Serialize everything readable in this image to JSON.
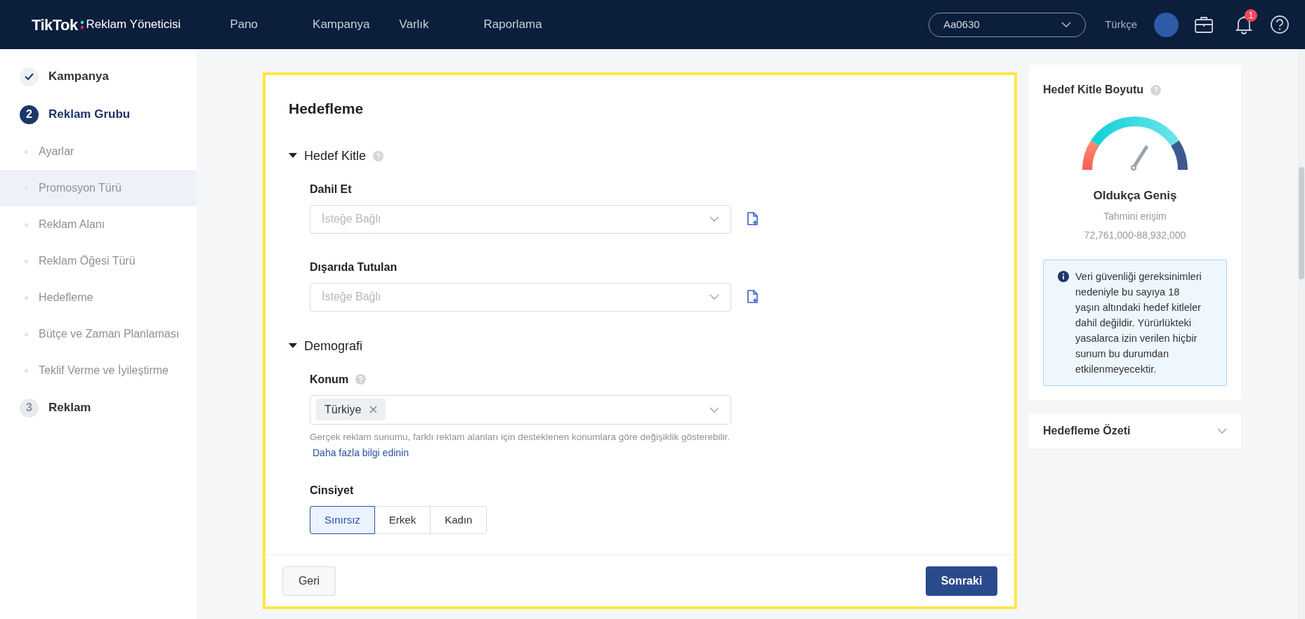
{
  "header": {
    "logo": "TikTok",
    "product": "Reklam Yöneticisi",
    "nav": [
      {
        "label": "Pano"
      },
      {
        "label": "Kampanya"
      },
      {
        "label": "Varlık"
      },
      {
        "label": "Raporlama"
      }
    ],
    "account": "Aa0630",
    "language": "Türkçe",
    "notification_count": "1"
  },
  "steps": [
    {
      "kind": "step",
      "label": "Kampanya",
      "completed": true,
      "selected": false
    },
    {
      "kind": "step",
      "number": "2",
      "label": "Reklam Grubu",
      "completed": false,
      "selected": true
    },
    {
      "kind": "substep",
      "label": "Ayarlar",
      "selected": false
    },
    {
      "kind": "substep",
      "label": "Promosyon Türü",
      "selected": true
    },
    {
      "kind": "substep",
      "label": "Reklam Alanı",
      "selected": false
    },
    {
      "kind": "substep",
      "label": "Reklam Öğesi Türü",
      "selected": false
    },
    {
      "kind": "substep",
      "label": "Hedefleme",
      "selected": false
    },
    {
      "kind": "substep",
      "label": "Bütçe ve Zaman Planlaması",
      "selected": false
    },
    {
      "kind": "substep",
      "label": "Teklif Verme ve İyileştirme",
      "selected": false
    },
    {
      "kind": "step",
      "number": "3",
      "label": "Reklam",
      "completed": false,
      "selected": false
    }
  ],
  "form": {
    "title": "Hedefleme",
    "sections": [
      {
        "title": "Hedef Kitle",
        "expanded": true,
        "help": true,
        "fields": [
          {
            "kind": "select",
            "label": "Dahil Et",
            "placeholder": "İsteğe Bağlı"
          },
          {
            "kind": "select",
            "label": "Dışarıda Tutulan",
            "placeholder": "İsteğe Bağlı"
          }
        ]
      },
      {
        "title": "Demografi",
        "expanded": true,
        "fields": [
          {
            "kind": "tags",
            "label": "Konum",
            "help": true,
            "tags": [
              "Türkiye"
            ],
            "hint": "Gerçek reklam sunumu, farklı reklam alanları için desteklenen konumlara göre değişiklik gösterebilir.",
            "link": "Daha fazla bilgi edinin"
          },
          {
            "kind": "segmented",
            "label": "Cinsiyet",
            "options": [
              {
                "label": "Sınırsız",
                "selected": true
              },
              {
                "label": "Erkek",
                "selected": false
              },
              {
                "label": "Kadın",
                "selected": false
              }
            ]
          }
        ]
      }
    ],
    "back": "Geri",
    "next": "Sonraki"
  },
  "audience": {
    "title": "Hedef Kitle Boyutu",
    "verdict": "Oldukça Geniş",
    "caption": "Tahmini erişim",
    "range": "72,761,000-88,932,000",
    "notice": "Veri güvenliği gereksinimleri nedeniyle bu sayıya 18 yaşın altındaki hedef kitleler dahil değildir. Yürürlükteki yasalarca izin verilen hiçbir sunum bu durumdan etkilenmeyecektir."
  },
  "summary": {
    "title": "Hedefleme Özeti",
    "expanded": false
  }
}
